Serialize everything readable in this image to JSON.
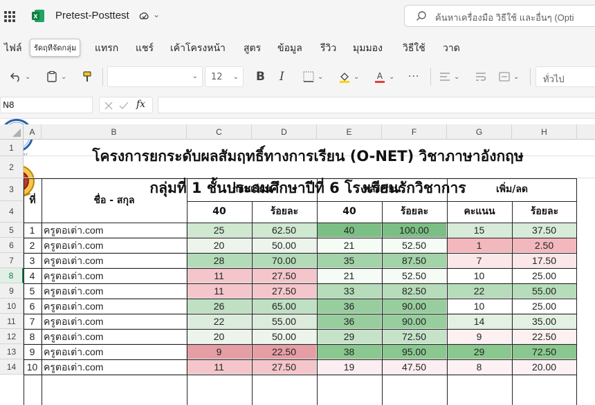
{
  "titlebar": {
    "doc_title": "Pretest-Posttest",
    "search_placeholder": "ค้นหาเครื่องมือ วิธีใช้ และอื่นๆ (Opti"
  },
  "menu": {
    "tabs": [
      "ไฟล์",
      "รัดฤทีจัดกลุ่ม",
      "แทรก",
      "แชร์",
      "เค้าโครงหน้า",
      "สูตร",
      "ข้อมูล",
      "รีวิว",
      "มุมมอง",
      "วิธีใช้",
      "วาด"
    ]
  },
  "ribbon": {
    "font_size": "12",
    "number_format": "ทั่วไป"
  },
  "formula_bar": {
    "name_box": "N8",
    "fx": "fx",
    "formula": ""
  },
  "grid": {
    "columns": [
      "A",
      "B",
      "C",
      "D",
      "E",
      "F",
      "G",
      "H"
    ],
    "rows": [
      "1",
      "2",
      "3",
      "4",
      "5",
      "6",
      "7",
      "8",
      "9",
      "10",
      "11",
      "12",
      "13",
      "14"
    ],
    "selected_row": "8"
  },
  "sheet": {
    "title1": "โครงการยกระดับผลสัมฤทธิ์ทางการเรียน (O-NET) วิชาภาษาอังกฤษ",
    "title2": "กลุ่มที่ 1 ชั้นประถมศึกษาปีที่ 6 โรงเรียนรักวิชาการ",
    "logo_left_text": "โรงเรียนรักวิชาการ",
    "hdr_no": "ที่",
    "hdr_name": "ชื่อ - สกุล",
    "hdr_pre": "ก่อนเรียน",
    "hdr_post": "หลังเรียน",
    "hdr_diff": "เพิ่ม/ลด",
    "sub_pre_score": "40",
    "sub_pre_pct": "ร้อยละ",
    "sub_post_score": "40",
    "sub_post_pct": "ร้อยละ",
    "sub_diff_score": "คะแนน",
    "sub_diff_pct": "ร้อยละ",
    "students": [
      {
        "no": "1",
        "name": "ครูตอเต่า.com",
        "pre": "25",
        "pre_pct": "62.50",
        "post": "40",
        "post_pct": "100.00",
        "diff": "15",
        "diff_pct": "37.50"
      },
      {
        "no": "2",
        "name": "ครูตอเต่า.com",
        "pre": "20",
        "pre_pct": "50.00",
        "post": "21",
        "post_pct": "52.50",
        "diff": "1",
        "diff_pct": "2.50"
      },
      {
        "no": "3",
        "name": "ครูตอเต่า.com",
        "pre": "28",
        "pre_pct": "70.00",
        "post": "35",
        "post_pct": "87.50",
        "diff": "7",
        "diff_pct": "17.50"
      },
      {
        "no": "4",
        "name": "ครูตอเต่า.com",
        "pre": "11",
        "pre_pct": "27.50",
        "post": "21",
        "post_pct": "52.50",
        "diff": "10",
        "diff_pct": "25.00"
      },
      {
        "no": "5",
        "name": "ครูตอเต่า.com",
        "pre": "11",
        "pre_pct": "27.50",
        "post": "33",
        "post_pct": "82.50",
        "diff": "22",
        "diff_pct": "55.00"
      },
      {
        "no": "6",
        "name": "ครูตอเต่า.com",
        "pre": "26",
        "pre_pct": "65.00",
        "post": "36",
        "post_pct": "90.00",
        "diff": "10",
        "diff_pct": "25.00"
      },
      {
        "no": "7",
        "name": "ครูตอเต่า.com",
        "pre": "22",
        "pre_pct": "55.00",
        "post": "36",
        "post_pct": "90.00",
        "diff": "14",
        "diff_pct": "35.00"
      },
      {
        "no": "8",
        "name": "ครูตอเต่า.com",
        "pre": "20",
        "pre_pct": "50.00",
        "post": "29",
        "post_pct": "72.50",
        "diff": "9",
        "diff_pct": "22.50"
      },
      {
        "no": "9",
        "name": "ครูตอเต่า.com",
        "pre": "9",
        "pre_pct": "22.50",
        "post": "38",
        "post_pct": "95.00",
        "diff": "29",
        "diff_pct": "72.50"
      },
      {
        "no": "10",
        "name": "ครูตอเต่า.com",
        "pre": "11",
        "pre_pct": "27.50",
        "post": "19",
        "post_pct": "47.50",
        "diff": "8",
        "diff_pct": "20.00"
      }
    ]
  },
  "cell_colors": [
    [
      "#cfe8d0",
      "#cfe8d0",
      "#7cbf84",
      "#7cbf84",
      "#d7ebd8",
      "#d7ebd8"
    ],
    [
      "#ecf4ec",
      "#ecf4ec",
      "#f5fbf5",
      "#f5fbf5",
      "#f2b8bd",
      "#f2b8bd"
    ],
    [
      "#b4dbb8",
      "#b4dbb8",
      "#a3d3a8",
      "#a3d3a8",
      "#fbe6e8",
      "#fbe6e8"
    ],
    [
      "#f4c6cb",
      "#f4c6cb",
      "#f5fbf5",
      "#f5fbf5",
      "#ffffff",
      "#ffffff"
    ],
    [
      "#f4c6cb",
      "#f4c6cb",
      "#b6dcba",
      "#b6dcba",
      "#b6dcba",
      "#b6dcba"
    ],
    [
      "#bfe0c2",
      "#bfe0c2",
      "#98ce9e",
      "#98ce9e",
      "#ffffff",
      "#ffffff"
    ],
    [
      "#dcecdc",
      "#dcecdc",
      "#98ce9e",
      "#98ce9e",
      "#e3f1e3",
      "#e3f1e3"
    ],
    [
      "#ecf4ec",
      "#ecf4ec",
      "#c6e3c9",
      "#c6e3c9",
      "#fcf0f1",
      "#fcf0f1"
    ],
    [
      "#e69ea5",
      "#e69ea5",
      "#8ac88f",
      "#8ac88f",
      "#8ac88f",
      "#8ac88f"
    ],
    [
      "#f4c6cb",
      "#f4c6cb",
      "#fbeef0",
      "#fbeef0",
      "#fdf2f3",
      "#fdf2f3"
    ]
  ]
}
